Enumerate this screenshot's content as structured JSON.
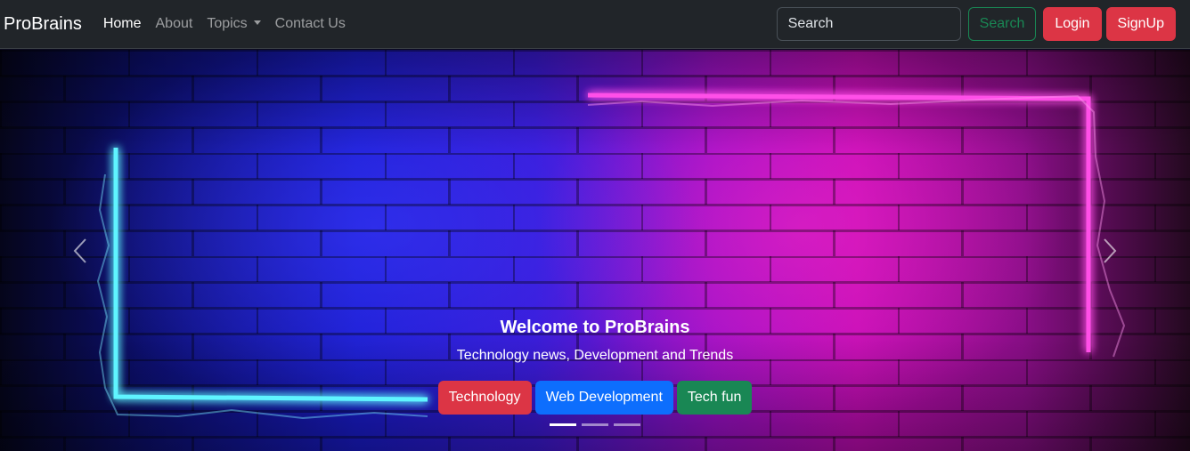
{
  "navbar": {
    "brand": "ProBrains",
    "links": [
      {
        "label": "Home",
        "active": true
      },
      {
        "label": "About"
      },
      {
        "label": "Topics",
        "dropdown": true
      },
      {
        "label": "Contact Us"
      }
    ],
    "search": {
      "placeholder": "Search",
      "value": ""
    },
    "search_button": "Search",
    "login_button": "Login",
    "signup_button": "SignUp"
  },
  "carousel": {
    "caption": {
      "title": "Welcome to ProBrains",
      "subtitle": "Technology news, Development and Trends"
    },
    "buttons": [
      "Technology",
      "Web Development",
      "Tech fun"
    ],
    "indicators": {
      "count": 3,
      "active_index": 0
    },
    "prev_icon": "chevron-left-icon",
    "next_icon": "chevron-right-icon"
  },
  "colors": {
    "navbar_bg": "#212529",
    "danger": "#dc3545",
    "primary": "#0d6efd",
    "success": "#198754",
    "neon_cyan": "#5ff4ff",
    "neon_pink": "#ff4fe8"
  }
}
